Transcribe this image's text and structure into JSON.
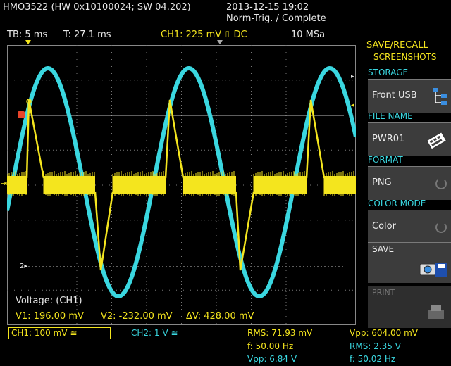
{
  "header": {
    "device": "HMO3522 (HW 0x10100024; SW 04.202)",
    "datetime": "2013-12-15 19:02",
    "trigger_status": "Norm-Trig. / Complete"
  },
  "status_bar": {
    "timebase": "TB: 5 ms",
    "trigger_time": "T: 27.1 ms",
    "channel": "CH1: 225 mV ⎍ DC",
    "sample_rate": "10 MSa"
  },
  "side_panel": {
    "title1": "SAVE/RECALL",
    "title2": "SCREENSHOTS",
    "storage_label": "STORAGE",
    "storage_value": "Front USB",
    "file_name_label": "FILE NAME",
    "file_name_value": "PWR01",
    "format_label": "FORMAT",
    "format_value": "PNG",
    "color_mode_label": "COLOR MODE",
    "color_mode_value": "Color",
    "save_label": "SAVE",
    "print_label": "PRINT"
  },
  "cursor_measure": {
    "title": "Voltage: (CH1)",
    "v1": "V1: 196.00 mV",
    "v2": "V2: -232.00 mV",
    "dv": "ΔV: 428.00 mV"
  },
  "bottom": {
    "ch1": "CH1: 100 mV ≅",
    "ch2": "CH2: 1 V ≅",
    "rms1": "RMS: 71.93 mV",
    "f1": "f: 50.00 Hz",
    "vpp2": "Vpp: 6.84 V",
    "vpp1": "Vpp: 604.00 mV",
    "rms2": "RMS: 2.35 V",
    "f2": "f: 50.02 Hz"
  },
  "colors": {
    "ch1": "#f4e51e",
    "ch2": "#3ad7e0",
    "panel_label": "#3ad7e0"
  }
}
